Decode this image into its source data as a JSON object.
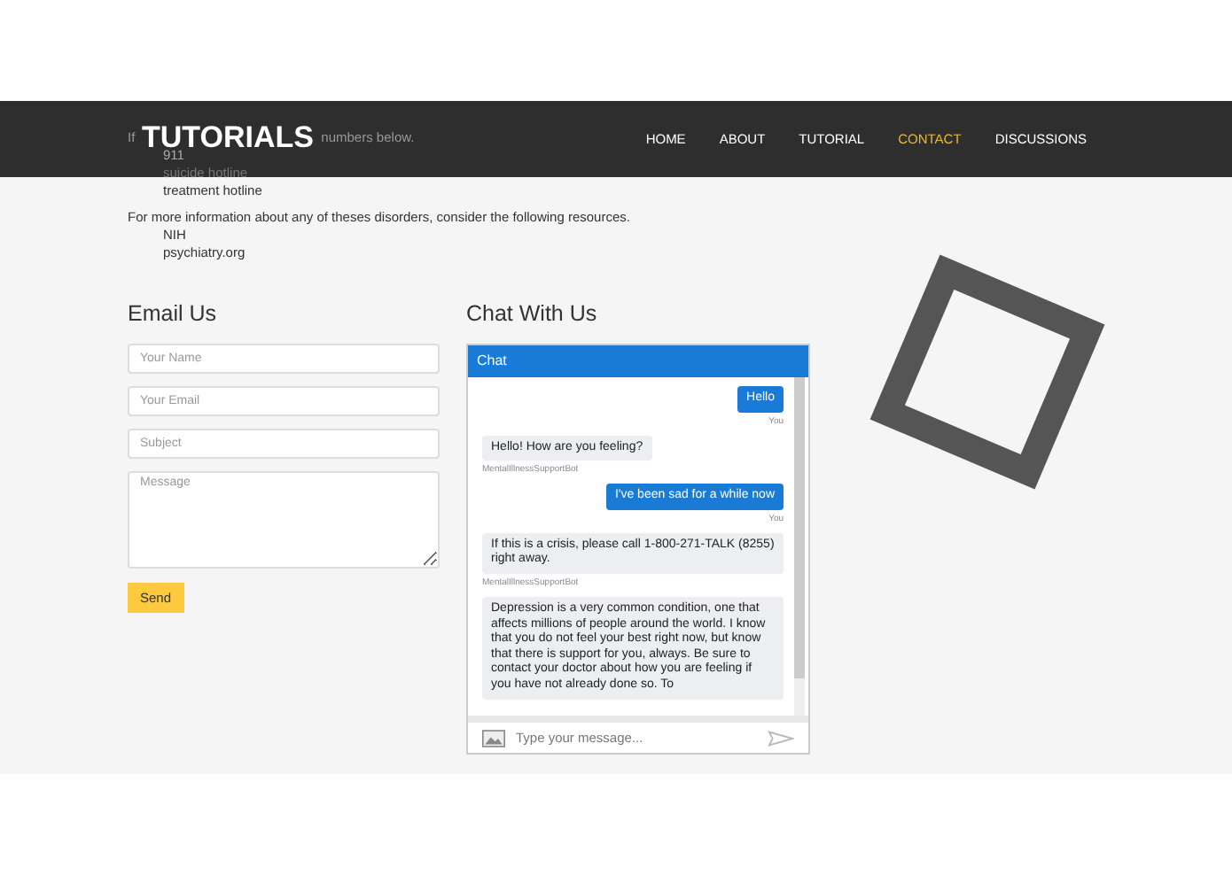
{
  "header": {
    "logo": "TUTORIALS",
    "nav": [
      {
        "label": "HOME",
        "selected": false
      },
      {
        "label": "ABOUT",
        "selected": false
      },
      {
        "label": "TUTORIAL",
        "selected": false
      },
      {
        "label": "CONTACT",
        "selected": true
      },
      {
        "label": "DISCUSSIONS",
        "selected": false
      }
    ]
  },
  "intro": {
    "fragments": [
      "If",
      "numbers below."
    ],
    "items": [
      "911",
      "suicide hotline",
      "treatment hotline"
    ]
  },
  "resources": {
    "text": "For more information about any of theses disorders, consider the following resources.",
    "items": [
      "NIH",
      "psychiatry.org"
    ]
  },
  "email": {
    "title": "Email Us",
    "fields": [
      {
        "kind": "input",
        "placeholder": "Your Name"
      },
      {
        "kind": "input",
        "placeholder": "Your Email"
      },
      {
        "kind": "input",
        "placeholder": "Subject"
      },
      {
        "kind": "textarea",
        "placeholder": "Message"
      }
    ],
    "button": "Send"
  },
  "chat": {
    "title": "Chat With Us",
    "header": "Chat",
    "messages": [
      {
        "kind": "user",
        "text": "Hello",
        "sender": "You"
      },
      {
        "kind": "bot",
        "text": "Hello! How are you feeling?",
        "sender": "MentalIllnessSupportBot"
      },
      {
        "kind": "user",
        "text": "I've been sad for a while now",
        "sender": "You"
      },
      {
        "kind": "bot",
        "text": "If this is a crisis, please call 1-800-271-TALK (8255) right away.",
        "sender": "MentalIllnessSupportBot"
      },
      {
        "kind": "bot",
        "text": "Depression is a very common condition, one that affects millions of people around the world. I know that you do not feel your best right now, but know that there is support for you, always. Be sure to contact your doctor about how you are feeling if you have not already done so. To"
      }
    ],
    "input_placeholder": "Type your message..."
  }
}
